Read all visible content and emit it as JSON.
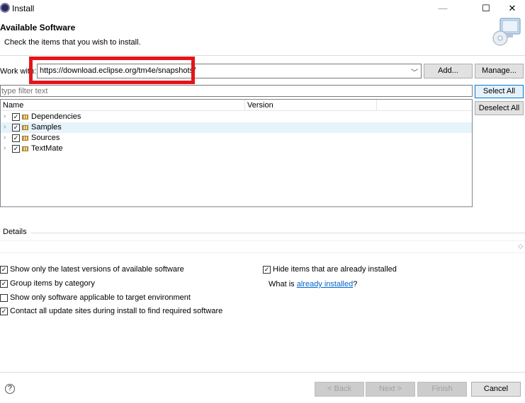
{
  "window": {
    "title": "Install",
    "minimize": "—",
    "maximize": "☐",
    "close": "✕"
  },
  "header": {
    "title": "Available Software",
    "description": "Check the items that you wish to install."
  },
  "workwith": {
    "label": "Work with:",
    "value": "https://download.eclipse.org/tm4e/snapshots/",
    "add_label": "Add...",
    "manage_label": "Manage..."
  },
  "filter": {
    "placeholder": "type filter text"
  },
  "buttons": {
    "select_all": "Select All",
    "deselect_all": "Deselect All"
  },
  "tree": {
    "columns": [
      "Name",
      "Version"
    ],
    "items": [
      {
        "label": "Dependencies",
        "checked": true
      },
      {
        "label": "Samples",
        "checked": true
      },
      {
        "label": "Sources",
        "checked": true
      },
      {
        "label": "TextMate",
        "checked": true
      }
    ]
  },
  "details": {
    "label": "Details"
  },
  "options": {
    "latest_versions": "Show only the latest versions of available software",
    "group_by_category": "Group items by category",
    "target_env": "Show only software applicable to target environment",
    "contact_sites": "Contact all update sites during install to find required software",
    "hide_installed": "Hide items that are already installed",
    "what_prefix": "What is ",
    "what_link": "already installed",
    "what_suffix": "?"
  },
  "footer": {
    "back": "< Back",
    "next": "Next >",
    "finish": "Finish",
    "cancel": "Cancel",
    "help": "?"
  }
}
